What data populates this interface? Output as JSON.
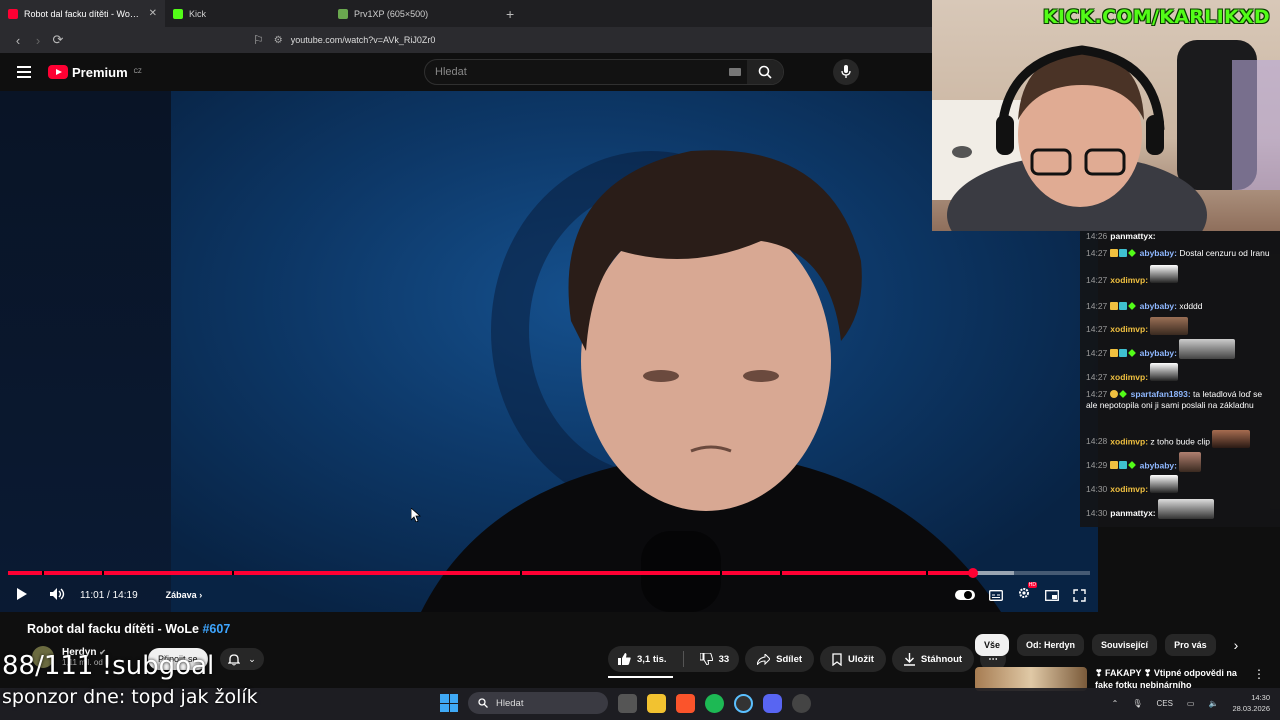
{
  "browser": {
    "tabs": [
      {
        "title": "Robot dal facku dítěti - WoLe #607",
        "favicon_color": "#ff0033",
        "active": true
      },
      {
        "title": "Kick",
        "favicon_color": "#53fc18",
        "active": false
      },
      {
        "title": "Prv1XP (605×500)",
        "favicon_color": "#6aa84f",
        "active": false
      }
    ],
    "url": "youtube.com/watch?v=AVk_RiJ0Zr0"
  },
  "youtube": {
    "logo_text": "Premium",
    "logo_region": "CZ",
    "search_placeholder": "Hledat",
    "video": {
      "time": "11:01 / 14:19",
      "chapter": "Zábava",
      "progress_played": 0.8916,
      "progress_buffered": 0.93
    },
    "title": "Robot dal facku dítěti - WoLe ",
    "title_tag": "#607",
    "channel_name": "Herdyn",
    "subs_text": "1,11 mil. od",
    "join_label": "Připojit se",
    "actions": {
      "likes": "3,1 tis.",
      "dislikes": "33",
      "share": "Sdílet",
      "save": "Uložit",
      "download": "Stáhnout"
    },
    "chips": [
      "Vše",
      "Od: Herdyn",
      "Související",
      "Pro vás"
    ],
    "rec_title": "❣ FAKAPY ❣ Vtipné odpovědi na fake fotku nebinárního"
  },
  "stream_overlay": {
    "kick_url": "KICK.COM/KARLIKXD",
    "subgoal": "88/111 !subgoal",
    "sponsor": "sponzor dne: topd jak žolík"
  },
  "chat": [
    {
      "ts": "14:26",
      "user": "panmattyx:",
      "text": "",
      "user_color": "#ffffff"
    },
    {
      "ts": "14:27",
      "user": "abybaby:",
      "text": " Dostal cenzuru od Iranu",
      "user_color": "#8fb8ff"
    },
    {
      "ts": "14:27",
      "user": "xodimvp:",
      "text": "",
      "user_color": "#f0c040"
    },
    {
      "ts": "14:27",
      "user": "abybaby:",
      "text": " xdddd",
      "user_color": "#8fb8ff"
    },
    {
      "ts": "14:27",
      "user": "xodimvp:",
      "text": "",
      "user_color": "#f0c040"
    },
    {
      "ts": "14:27",
      "user": "abybaby:",
      "text": "",
      "user_color": "#8fb8ff"
    },
    {
      "ts": "14:27",
      "user": "xodimvp:",
      "text": "",
      "user_color": "#f0c040"
    },
    {
      "ts": "14:27",
      "user": "spartafan1893:",
      "text": " ta letadlová loď se ale nepotopila oni ji sami poslali na základnu",
      "user_color": "#8fb8ff"
    },
    {
      "ts": "14:28",
      "user": "xodimvp:",
      "text": " z toho bude clip",
      "user_color": "#f0c040"
    },
    {
      "ts": "14:29",
      "user": "abybaby:",
      "text": "",
      "user_color": "#8fb8ff"
    },
    {
      "ts": "14:30",
      "user": "xodimvp:",
      "text": "",
      "user_color": "#f0c040"
    },
    {
      "ts": "14:30",
      "user": "panmattyx:",
      "text": "",
      "user_color": "#ffffff"
    }
  ],
  "taskbar": {
    "search_placeholder": "Hledat",
    "lang": "CES",
    "time": "14:30",
    "date": "28.03.2026"
  }
}
